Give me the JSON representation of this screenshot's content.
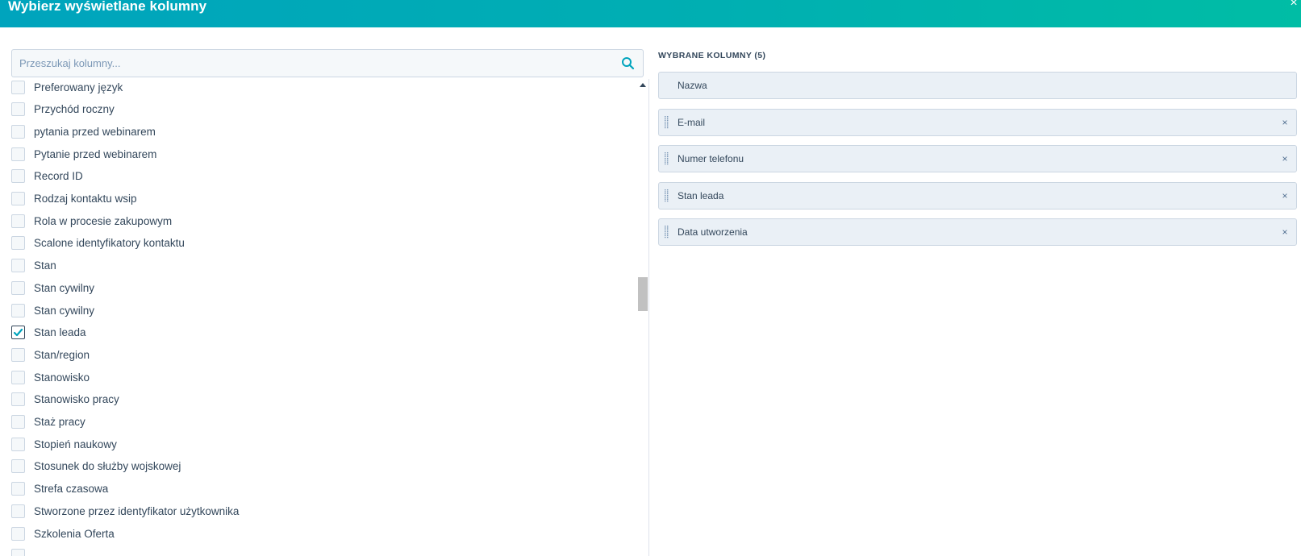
{
  "dialog": {
    "title": "Wybierz wyświetlane kolumny",
    "close_glyph": "×"
  },
  "search": {
    "placeholder": "Przeszukaj kolumny...",
    "value": "",
    "icon": "search-icon"
  },
  "available_columns": [
    {
      "label": "Preferowany język",
      "checked": false
    },
    {
      "label": "Przychód roczny",
      "checked": false
    },
    {
      "label": "pytania przed webinarem",
      "checked": false
    },
    {
      "label": "Pytanie przed webinarem",
      "checked": false
    },
    {
      "label": "Record ID",
      "checked": false
    },
    {
      "label": "Rodzaj kontaktu wsip",
      "checked": false
    },
    {
      "label": "Rola w procesie zakupowym",
      "checked": false
    },
    {
      "label": "Scalone identyfikatory kontaktu",
      "checked": false
    },
    {
      "label": "Stan",
      "checked": false
    },
    {
      "label": "Stan cywilny",
      "checked": false
    },
    {
      "label": "Stan cywilny",
      "checked": false
    },
    {
      "label": "Stan leada",
      "checked": true
    },
    {
      "label": "Stan/region",
      "checked": false
    },
    {
      "label": "Stanowisko",
      "checked": false
    },
    {
      "label": "Stanowisko pracy",
      "checked": false
    },
    {
      "label": "Staż pracy",
      "checked": false
    },
    {
      "label": "Stopień naukowy",
      "checked": false
    },
    {
      "label": "Stosunek do służby wojskowej",
      "checked": false
    },
    {
      "label": "Strefa czasowa",
      "checked": false
    },
    {
      "label": "Stworzone przez identyfikator użytkownika",
      "checked": false
    },
    {
      "label": "Szkolenia Oferta",
      "checked": false
    },
    {
      "label": "",
      "checked": false
    }
  ],
  "selected": {
    "title": "WYBRANE KOLUMNY (5)",
    "items": [
      {
        "label": "Nazwa",
        "removable": false,
        "draggable": false
      },
      {
        "label": "E-mail",
        "removable": true,
        "draggable": true
      },
      {
        "label": "Numer telefonu",
        "removable": true,
        "draggable": true
      },
      {
        "label": "Stan leada",
        "removable": true,
        "draggable": true
      },
      {
        "label": "Data utworzenia",
        "removable": true,
        "draggable": true
      }
    ],
    "remove_glyph": "×"
  },
  "colors": {
    "header_gradient_start": "#00a4bd",
    "header_gradient_end": "#00bda5",
    "text": "#33475b",
    "accent": "#00a4bd",
    "chip_bg": "#eaf0f6",
    "border": "#cbd6e2"
  }
}
